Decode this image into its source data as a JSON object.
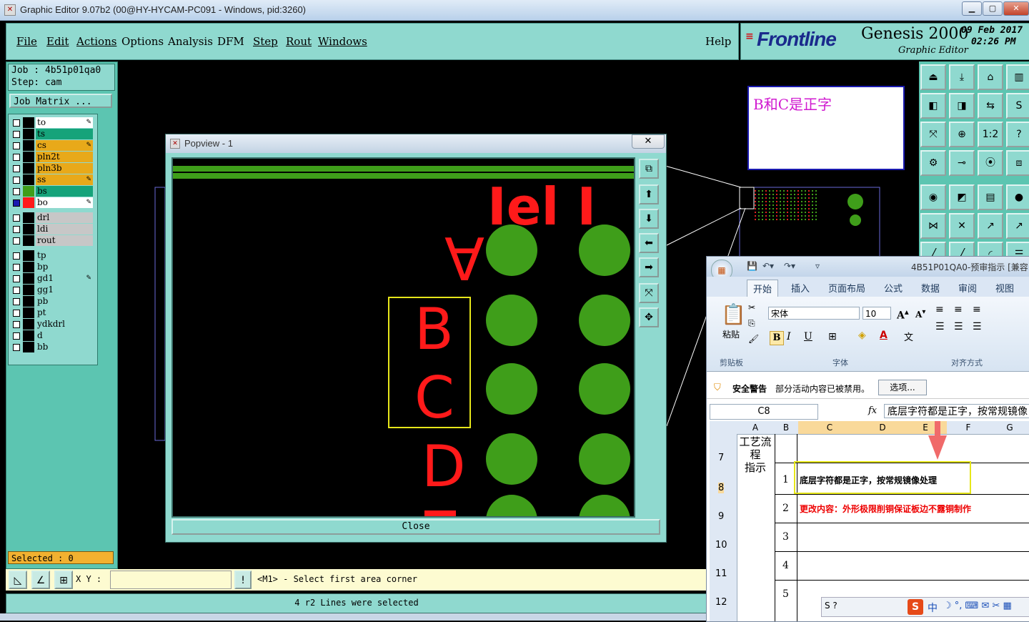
{
  "window": {
    "title": "Graphic Editor 9.07b2 (00@HY-HYCAM-PC091 - Windows, pid:3260)"
  },
  "menu": [
    "File",
    "Edit",
    "Actions",
    "Options",
    "Analysis",
    "DFM",
    "Step",
    "Rout",
    "Windows"
  ],
  "help": "Help",
  "brand": {
    "logo": "Frontline",
    "product": "Genesis 2000",
    "sub": "Graphic Editor",
    "date": "09 Feb 2017",
    "time": "02:26 PM"
  },
  "job": {
    "job": "Job : 4b51p01qa0",
    "step": "Step: cam",
    "matrix": "Job Matrix ..."
  },
  "layers": [
    {
      "name": "to",
      "bg": "#ffffff",
      "sw": "#000000",
      "flag": true
    },
    {
      "name": "ts",
      "bg": "#16a37a",
      "sw": "#000000",
      "flag": false
    },
    {
      "name": "cs",
      "bg": "#e8a91a",
      "sw": "#000000",
      "flag": true
    },
    {
      "name": "pln2t",
      "bg": "#e8a91a",
      "sw": "#000000",
      "flag": false
    },
    {
      "name": "pln3b",
      "bg": "#e8a91a",
      "sw": "#000000",
      "flag": false
    },
    {
      "name": "ss",
      "bg": "#e8a91a",
      "sw": "#000000",
      "flag": true
    },
    {
      "name": "bs",
      "bg": "#16a37a",
      "sw": "#3f9e1a",
      "flag": false
    },
    {
      "name": "bo",
      "bg": "#ffffff",
      "sw": "#ff1a1a",
      "flag": true
    },
    {
      "name": "drl",
      "bg": "#c7c7c7",
      "sw": "#000000",
      "flag": false
    },
    {
      "name": "ldi",
      "bg": "#c7c7c7",
      "sw": "#000000",
      "flag": false
    },
    {
      "name": "rout",
      "bg": "#c7c7c7",
      "sw": "#000000",
      "flag": false
    },
    {
      "name": "tp",
      "bg": "#8fd9cf",
      "sw": "#000000",
      "flag": false
    },
    {
      "name": "bp",
      "bg": "#8fd9cf",
      "sw": "#000000",
      "flag": false
    },
    {
      "name": "gd1",
      "bg": "#8fd9cf",
      "sw": "#000000",
      "flag": true
    },
    {
      "name": "gg1",
      "bg": "#8fd9cf",
      "sw": "#000000",
      "flag": false
    },
    {
      "name": "pb",
      "bg": "#8fd9cf",
      "sw": "#000000",
      "flag": false
    },
    {
      "name": "pt",
      "bg": "#8fd9cf",
      "sw": "#000000",
      "flag": false
    },
    {
      "name": "ydkdrl",
      "bg": "#8fd9cf",
      "sw": "#000000",
      "flag": false
    },
    {
      "name": "d",
      "bg": "#8fd9cf",
      "sw": "#000000",
      "flag": false
    },
    {
      "name": "bb",
      "bg": "#8fd9cf",
      "sw": "#000000",
      "flag": false
    }
  ],
  "selected": "Selected : 0",
  "popview": {
    "title": "Popview - 1",
    "close": "Close",
    "letters": [
      "A",
      "B",
      "C",
      "D"
    ],
    "top_text": "Iel I"
  },
  "note": "B和C是正字",
  "xy_label": "X Y :",
  "prompt": "<M1> - Select first area corner",
  "status": "4 r2 Lines were selected",
  "excel": {
    "title": "4B51P01QA0-预审指示 [兼容",
    "tabs": [
      "开始",
      "插入",
      "页面布局",
      "公式",
      "数据",
      "审阅",
      "视图"
    ],
    "font_name": "宋体",
    "font_size": "10",
    "paste": "粘贴",
    "groups": [
      "剪贴板",
      "字体",
      "对齐方式"
    ],
    "security_title": "安全警告",
    "security_msg": "部分活动内容已被禁用。",
    "options_btn": "选项...",
    "name_box": "C8",
    "fx": "fx",
    "formula": "底层字符都是正字，按常规镜像",
    "columns": [
      "A",
      "B",
      "C",
      "D",
      "E",
      "F",
      "G"
    ],
    "rows": [
      "7",
      "8",
      "9",
      "10",
      "11",
      "12"
    ],
    "a7": "工艺流程指示",
    "a7_line1": "工艺流程",
    "a7_line2": "指示",
    "b_nums": [
      "1",
      "2",
      "3",
      "4",
      "5"
    ],
    "c8": "底层字符都是正字，按常规镜像处理",
    "c9": "更改内容：外形极限削铜保证板边不露铜制作"
  },
  "ime": {
    "mode": "中"
  }
}
